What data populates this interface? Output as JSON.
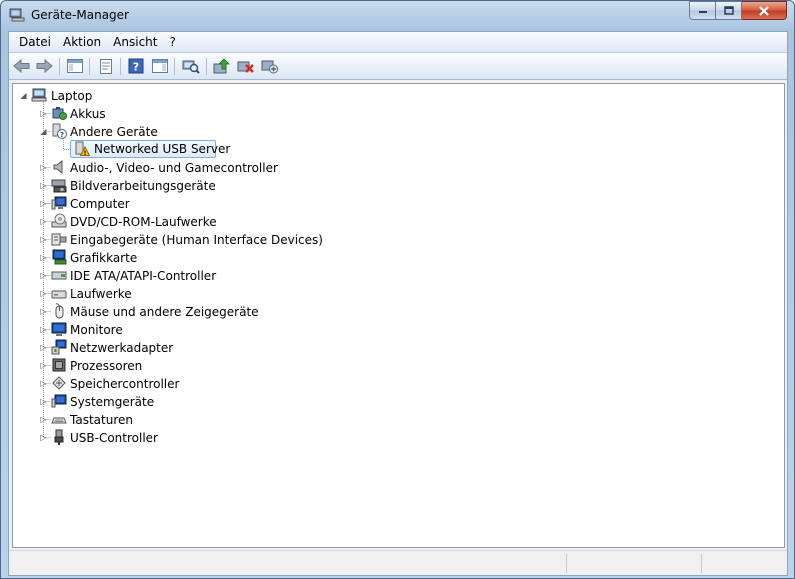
{
  "window": {
    "title": "Geräte-Manager",
    "title_icon": "device-manager-icon",
    "controls": [
      "minimize-icon",
      "maximize-icon",
      "close-icon"
    ]
  },
  "menu": {
    "items": [
      {
        "label": "Datei"
      },
      {
        "label": "Aktion"
      },
      {
        "label": "Ansicht"
      },
      {
        "label": "?"
      }
    ]
  },
  "toolbar": {
    "buttons": [
      {
        "icon": "back-arrow-icon"
      },
      {
        "icon": "forward-arrow-icon"
      },
      {
        "icon": "show-hide-console-tree-icon"
      },
      {
        "icon": "properties-icon"
      },
      {
        "icon": "help-icon"
      },
      {
        "icon": "show-action-pane-icon"
      },
      {
        "icon": "scan-hardware-icon"
      },
      {
        "icon": "update-driver-icon"
      },
      {
        "icon": "uninstall-icon"
      },
      {
        "icon": "disable-device-icon"
      }
    ]
  },
  "tree": {
    "root": {
      "label": "Laptop",
      "icon": "computer-icon",
      "expanded": true
    },
    "categories": [
      {
        "label": "Akkus",
        "icon": "battery-icon",
        "expanded": false
      },
      {
        "label": "Andere Geräte",
        "icon": "unknown-device-icon",
        "expanded": true,
        "children": [
          {
            "label": "Networked USB Server",
            "icon": "warning-device-icon",
            "selected": true
          }
        ]
      },
      {
        "label": "Audio-, Video- und Gamecontroller",
        "icon": "speaker-icon",
        "expanded": false
      },
      {
        "label": "Bildverarbeitungsgeräte",
        "icon": "camera-icon",
        "expanded": false
      },
      {
        "label": "Computer",
        "icon": "monitor-icon",
        "expanded": false
      },
      {
        "label": "DVD/CD-ROM-Laufwerke",
        "icon": "optical-drive-icon",
        "expanded": false
      },
      {
        "label": "Eingabegeräte (Human Interface Devices)",
        "icon": "hid-icon",
        "expanded": false
      },
      {
        "label": "Grafikkarte",
        "icon": "display-adapter-icon",
        "expanded": false
      },
      {
        "label": "IDE ATA/ATAPI-Controller",
        "icon": "ide-controller-icon",
        "expanded": false
      },
      {
        "label": "Laufwerke",
        "icon": "disk-drive-icon",
        "expanded": false
      },
      {
        "label": "Mäuse und andere Zeigegeräte",
        "icon": "mouse-icon",
        "expanded": false
      },
      {
        "label": "Monitore",
        "icon": "monitor-icon",
        "expanded": false
      },
      {
        "label": "Netzwerkadapter",
        "icon": "network-adapter-icon",
        "expanded": false
      },
      {
        "label": "Prozessoren",
        "icon": "processor-icon",
        "expanded": false
      },
      {
        "label": "Speichercontroller",
        "icon": "storage-controller-icon",
        "expanded": false
      },
      {
        "label": "Systemgeräte",
        "icon": "system-device-icon",
        "expanded": false
      },
      {
        "label": "Tastaturen",
        "icon": "keyboard-icon",
        "expanded": false
      },
      {
        "label": "USB-Controller",
        "icon": "usb-icon",
        "expanded": false
      }
    ]
  },
  "colors": {
    "selection_border": "#84acdd",
    "selection_fill": "#dcebfc",
    "warning": "#f2c21a"
  }
}
